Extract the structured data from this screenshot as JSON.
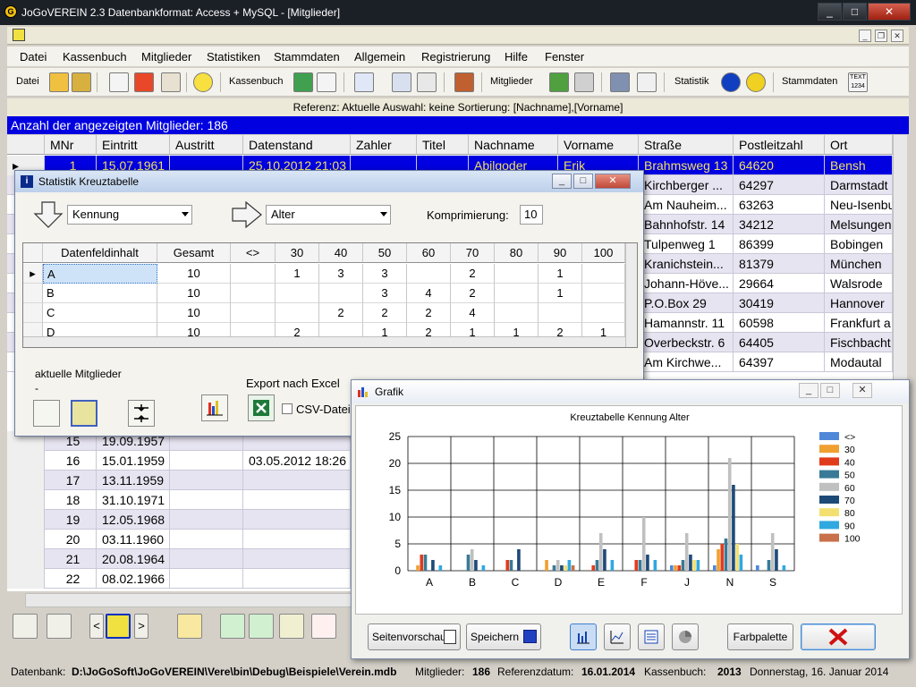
{
  "window": {
    "title": "JoGoVEREIN 2.3 Datenbankformat: Access + MySQL - [Mitglieder]",
    "minimize": "_",
    "maximize": "□",
    "close": "✕"
  },
  "menu": [
    "Datei",
    "Kassenbuch",
    "Mitglieder",
    "Statistiken",
    "Stammdaten",
    "Allgemein",
    "Registrierung",
    "Hilfe",
    "Fenster"
  ],
  "toolbar": {
    "datei": "Datei",
    "kassenbuch": "Kassenbuch",
    "mitglieder": "Mitglieder",
    "statistik": "Statistik",
    "stammdaten": "Stammdaten",
    "text_icon": "TEXT 1234"
  },
  "reference_line": "Referenz: Aktuelle  Auswahl: keine  Sortierung: [Nachname],[Vorname]",
  "count_line": "Anzahl der angezeigten Mitglieder: 186",
  "grid": {
    "columns": [
      "MNr",
      "Eintritt",
      "Austritt",
      "Datenstand",
      "Zahler",
      "Titel",
      "Nachname",
      "Vorname",
      "Straße",
      "Postleitzahl",
      "Ort"
    ],
    "top_rows": [
      {
        "mnr": "1",
        "eintritt": "15.07.1961",
        "austritt": "",
        "datenstand": "25.10.2012 21:03",
        "zahler": "",
        "titel": "",
        "nachname": "Abilgoder",
        "vorname": "Erik",
        "strasse": "Brahmsweg 13",
        "plz": "64620",
        "ort": "Bensh"
      },
      {
        "strasse": "Kirchberger ...",
        "plz": "64297",
        "ort": "Darmstadt"
      },
      {
        "strasse": "Am Nauheim...",
        "plz": "63263",
        "ort": "Neu-Isenbu"
      },
      {
        "strasse": "Bahnhofstr. 14",
        "plz": "34212",
        "ort": "Melsungen"
      },
      {
        "strasse": "Tulpenweg 1",
        "plz": "86399",
        "ort": "Bobingen"
      },
      {
        "strasse": "Kranichstein...",
        "plz": "81379",
        "ort": "München"
      },
      {
        "strasse": "Johann-Höve...",
        "plz": "29664",
        "ort": "Walsrode"
      },
      {
        "strasse": "P.O.Box 29",
        "plz": "30419",
        "ort": "Hannover"
      },
      {
        "strasse": "Hamannstr. 11",
        "plz": "60598",
        "ort": "Frankfurt a"
      },
      {
        "strasse": "Overbeckstr. 6",
        "plz": "64405",
        "ort": "Fischbacht"
      },
      {
        "strasse": "Am  Kirchwe...",
        "plz": "64397",
        "ort": "Modautal"
      }
    ],
    "bottom_rows": [
      {
        "mnr": "15",
        "eintritt": "19.09.1957",
        "datenstand": ""
      },
      {
        "mnr": "16",
        "eintritt": "15.01.1959",
        "datenstand": "03.05.2012 18:26"
      },
      {
        "mnr": "17",
        "eintritt": "13.11.1959",
        "datenstand": ""
      },
      {
        "mnr": "18",
        "eintritt": "31.10.1971",
        "datenstand": ""
      },
      {
        "mnr": "19",
        "eintritt": "12.05.1968",
        "datenstand": ""
      },
      {
        "mnr": "20",
        "eintritt": "03.11.1960",
        "datenstand": ""
      },
      {
        "mnr": "21",
        "eintritt": "20.08.1964",
        "datenstand": ""
      },
      {
        "mnr": "22",
        "eintritt": "08.02.1966",
        "datenstand": ""
      }
    ]
  },
  "status": {
    "db_label": "Datenbank:",
    "db_path": "D:\\JoGoSoft\\JoGoVEREIN\\Vere\\bin\\Debug\\Beispiele\\Verein.mdb",
    "mitglieder_label": "Mitglieder:",
    "mitglieder": "186",
    "ref_label": "Referenzdatum:",
    "ref_date": "16.01.2014",
    "kasse_label": "Kassenbuch:",
    "kasse": "2013",
    "date": "Donnerstag, 16. Januar 2014"
  },
  "kreuztabelle": {
    "title": "Statistik Kreuztabelle",
    "row_field": "Kennung",
    "col_field": "Alter",
    "komprimierung_label": "Komprimierung:",
    "komprimierung": "10",
    "headers": [
      "Datenfeldinhalt",
      "Gesamt",
      "<>",
      "30",
      "40",
      "50",
      "60",
      "70",
      "80",
      "90",
      "100"
    ],
    "rows": [
      [
        "A",
        "10",
        "",
        "1",
        "3",
        "3",
        "",
        "2",
        "",
        "1",
        ""
      ],
      [
        "B",
        "10",
        "",
        "",
        "",
        "3",
        "4",
        "2",
        "",
        "1",
        ""
      ],
      [
        "C",
        "10",
        "",
        "",
        "2",
        "2",
        "2",
        "4",
        "",
        "",
        ""
      ],
      [
        "D",
        "10",
        "",
        "2",
        "",
        "1",
        "2",
        "1",
        "1",
        "2",
        "1"
      ]
    ],
    "aktuelle_label": "aktuelle Mitglieder",
    "aktuelle_value": "-",
    "export_label": "Export nach Excel",
    "csv_label": "CSV-Datei"
  },
  "grafik": {
    "title": "Grafik",
    "buttons": {
      "seitenvorschau": "Seitenvorschau",
      "speichern": "Speichern",
      "farbpalette": "Farbpalette"
    }
  },
  "chart_data": {
    "type": "bar",
    "title": "Kreuztabelle Kennung  Alter",
    "categories": [
      "A",
      "B",
      "C",
      "D",
      "E",
      "F",
      "J",
      "N",
      "S"
    ],
    "yticks": [
      0,
      5,
      10,
      15,
      20,
      25
    ],
    "ylim": [
      0,
      25
    ],
    "legend": "right",
    "series": [
      {
        "name": "<>",
        "color": "#4f88d8",
        "values": [
          0,
          0,
          0,
          0,
          0,
          0,
          1,
          1,
          1
        ]
      },
      {
        "name": "30",
        "color": "#f0a030",
        "values": [
          1,
          0,
          0,
          2,
          0,
          0,
          1,
          4,
          0
        ]
      },
      {
        "name": "40",
        "color": "#e03c1c",
        "values": [
          3,
          0,
          2,
          0,
          1,
          2,
          1,
          5,
          0
        ]
      },
      {
        "name": "50",
        "color": "#3a7a96",
        "values": [
          3,
          3,
          2,
          1,
          2,
          2,
          2,
          6,
          2
        ]
      },
      {
        "name": "60",
        "color": "#c0c0c0",
        "values": [
          0,
          4,
          0,
          2,
          7,
          10,
          7,
          21,
          7
        ]
      },
      {
        "name": "70",
        "color": "#1e4a78",
        "values": [
          2,
          2,
          4,
          1,
          4,
          3,
          3,
          16,
          4
        ]
      },
      {
        "name": "80",
        "color": "#f4e070",
        "values": [
          0,
          0,
          0,
          1,
          0,
          0,
          2,
          5,
          0
        ]
      },
      {
        "name": "90",
        "color": "#30a8e0",
        "values": [
          1,
          1,
          0,
          2,
          2,
          2,
          2,
          3,
          1
        ]
      },
      {
        "name": "100",
        "color": "#c8704a",
        "values": [
          0,
          0,
          0,
          1,
          0,
          0,
          0,
          0,
          0
        ]
      }
    ]
  }
}
